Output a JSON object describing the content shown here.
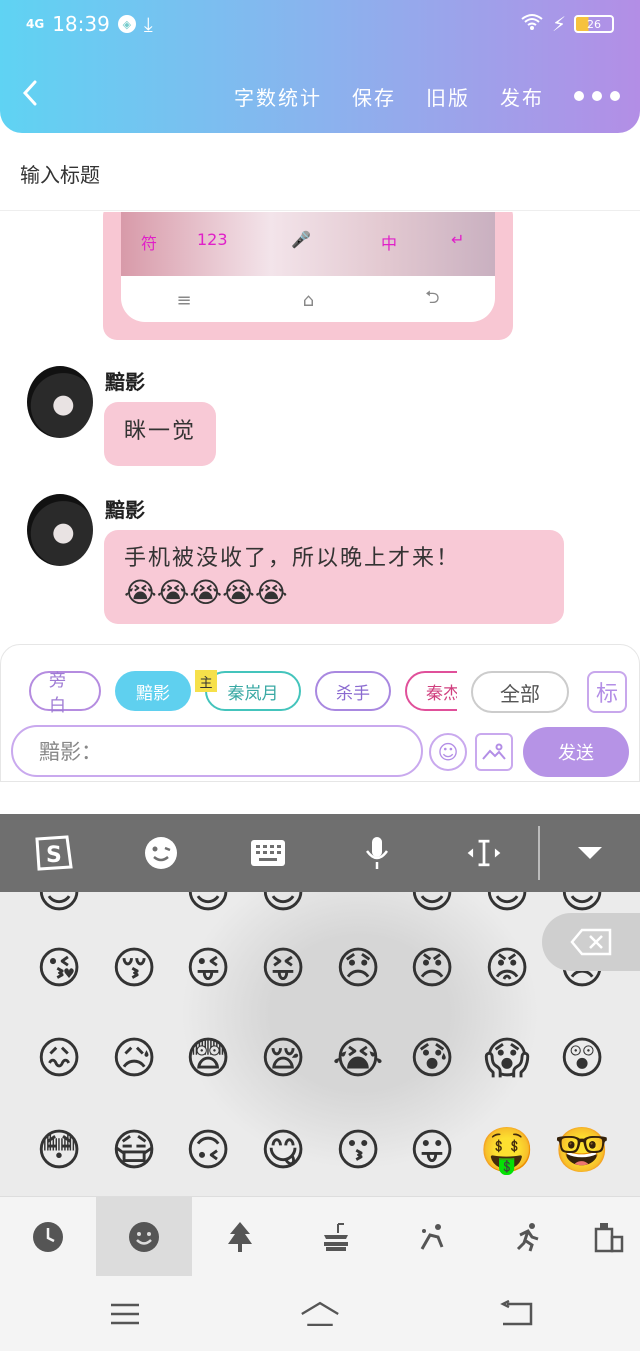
{
  "status": {
    "network": "4G",
    "time": "18:39",
    "battery": "26"
  },
  "toolbar": {
    "back_icon": "chevron-left-icon",
    "word_count": "字数统计",
    "save": "保存",
    "old_version": "旧版",
    "publish": "发布"
  },
  "title_placeholder": "输入标题",
  "screenshot_keys": [
    "符",
    "123",
    "中"
  ],
  "messages": [
    {
      "name": "黯影",
      "text": "眯一觉",
      "emojis": ""
    },
    {
      "name": "黯影",
      "text": "手机被没收了，所以晚上才来！",
      "emojis": "😭😭😭😭😭"
    }
  ],
  "composer": {
    "chips": [
      "旁白",
      "黯影",
      "秦岚月",
      "杀手",
      "秦杰"
    ],
    "master_badge": "主",
    "all": "全部",
    "tag_button": "标",
    "input_placeholder": "黯影：",
    "send": "发送"
  },
  "keyboard": {
    "toolbar_icons": [
      "sogou-logo-icon",
      "emoji-icon",
      "keyboard-icon",
      "microphone-icon",
      "cursor-icon",
      "collapse-icon"
    ],
    "emoji_rows": [
      [
        "😘",
        "😚",
        "😜",
        "😝",
        "😞",
        "😠",
        "😡",
        "😥"
      ],
      [
        "😖",
        "😥",
        "😨",
        "😪",
        "😭",
        "😰",
        "😱",
        "😲"
      ],
      [
        "😳",
        "😷",
        "🙃",
        "😋",
        "😗",
        "😛",
        "🤑",
        "🤓"
      ]
    ],
    "categories": [
      "recent-icon",
      "smiley-icon",
      "nature-icon",
      "food-icon",
      "activity-icon",
      "travel-icon",
      "building-icon"
    ]
  }
}
